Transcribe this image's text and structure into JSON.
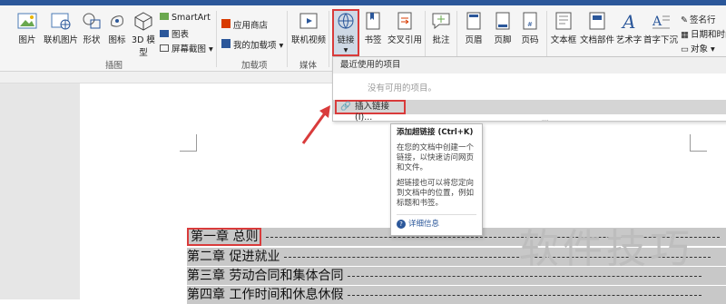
{
  "ribbon": {
    "buttons": [
      {
        "label": "图片"
      },
      {
        "label": "联机图片"
      },
      {
        "label": "形状"
      },
      {
        "label": "图标"
      },
      {
        "label": "3D 模型"
      },
      {
        "label": "联机视频"
      },
      {
        "label": "链接"
      },
      {
        "label": "书签"
      },
      {
        "label": "交叉引用"
      },
      {
        "label": "批注"
      },
      {
        "label": "页眉"
      },
      {
        "label": "页脚"
      },
      {
        "label": "页码"
      },
      {
        "label": "文本框"
      },
      {
        "label": "文档部件"
      },
      {
        "label": "艺术字"
      },
      {
        "label": "首字下沉"
      }
    ],
    "smartart": "SmartArt",
    "chart": "图表",
    "screenshot": "屏幕截图",
    "store": "应用商店",
    "my_addins": "我的加载项",
    "signature": "签名行",
    "datetime": "日期和时间",
    "object": "对象",
    "groups": {
      "illustrations": "插图",
      "addins": "加载项",
      "media": "媒体"
    }
  },
  "dropdown": {
    "header": "最近使用的项目",
    "empty": "没有可用的项目。",
    "insert_link": "插入链接(I)..."
  },
  "tooltip": {
    "title": "添加超链接 (Ctrl+K)",
    "p1": "在您的文档中创建一个链接，以快速访问网页和文件。",
    "p2": "超链接也可以将您定向到文档中的位置，例如标题和书签。",
    "more": "详细信息"
  },
  "toc": [
    {
      "text": "第一章  总则"
    },
    {
      "text": "第二章  促进就业"
    },
    {
      "text": "第三章  劳动合同和集体合同"
    },
    {
      "text": "第四章  工作时间和休息休假"
    }
  ],
  "watermark": "软件技巧",
  "colors": {
    "accent": "#2b579a",
    "highlight_red": "#d93b3b",
    "toc_gray": "#c8c8c8"
  }
}
